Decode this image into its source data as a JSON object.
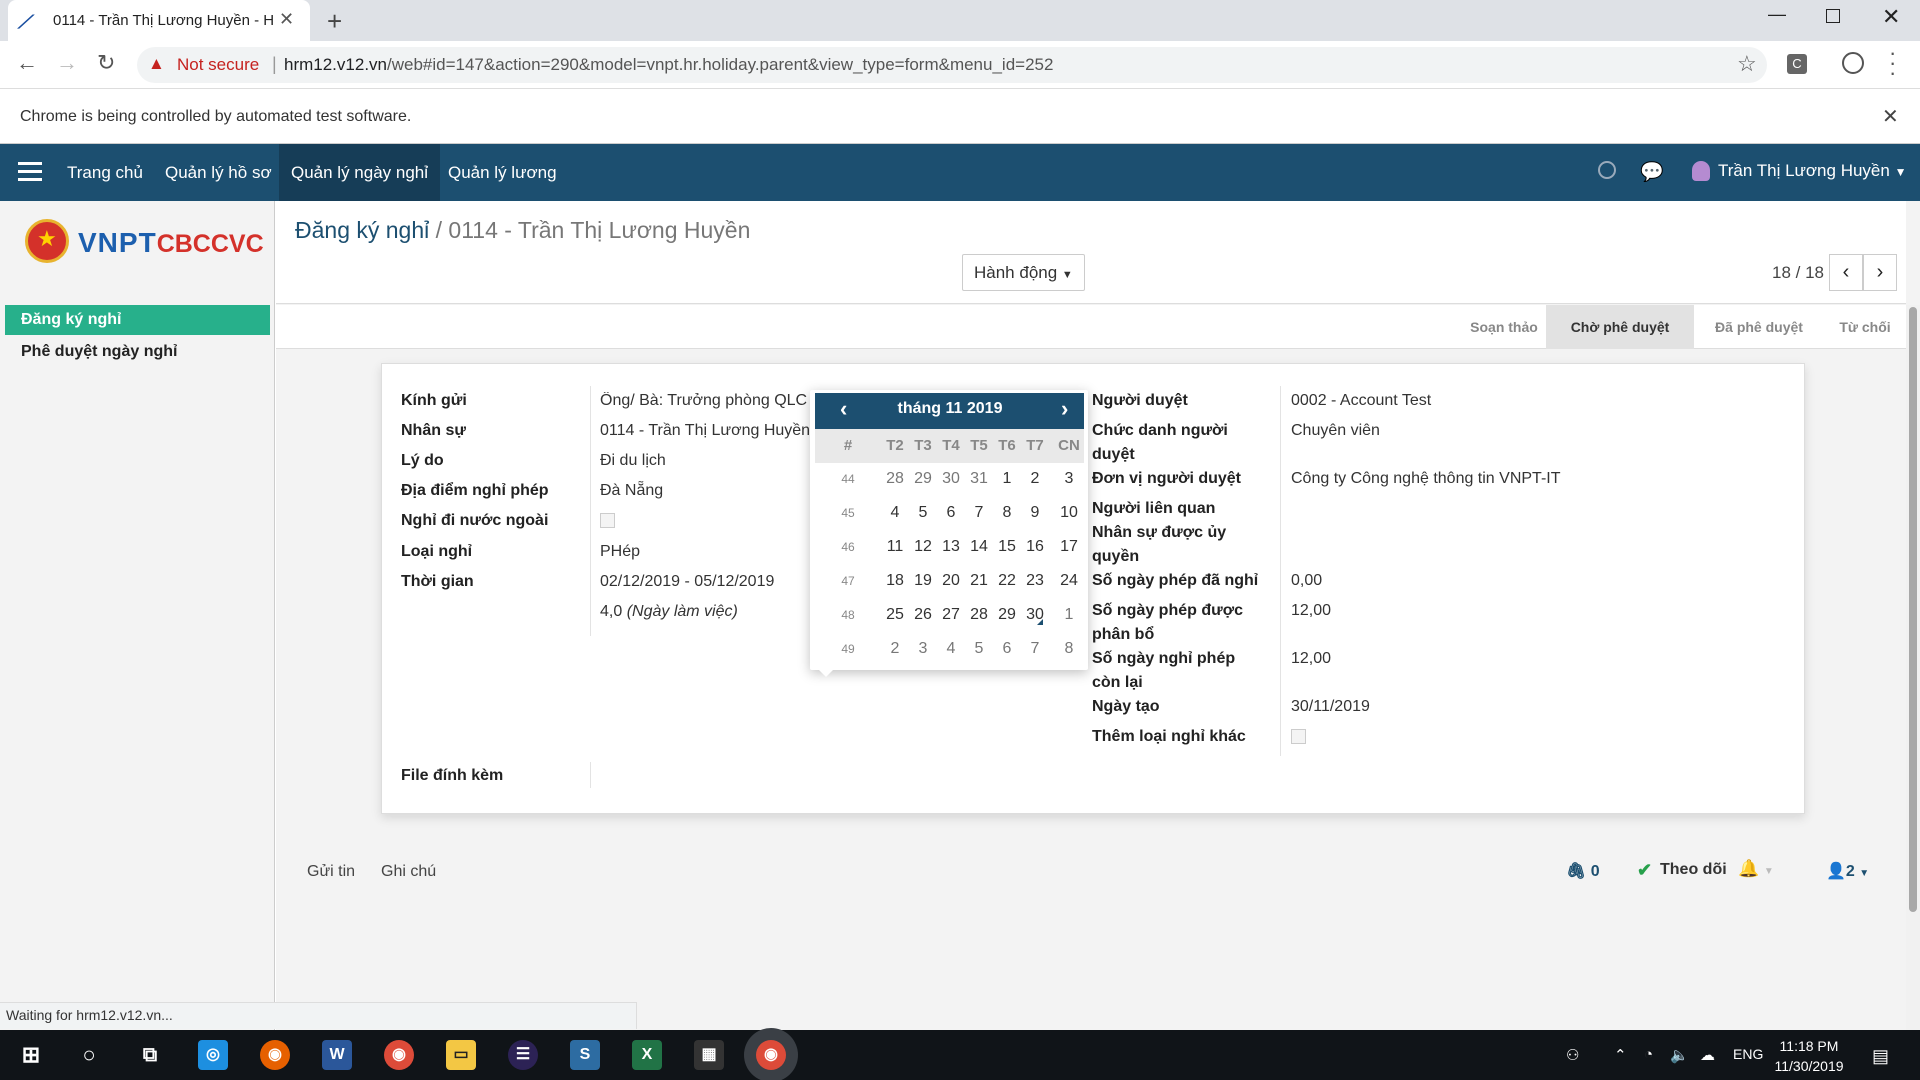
{
  "browser": {
    "tab_title": "0114 - Trần Thị Lương Huyền - H",
    "not_secure": "Not secure",
    "url_host": "hrm12.v12.vn",
    "url_path": "/web#id=147&action=290&model=vnpt.hr.holiday.parent&view_type=form&menu_id=252",
    "infobar": "Chrome is being controlled by automated test software.",
    "status_tip": "Waiting for hrm12.v12.vn..."
  },
  "nav": {
    "items": [
      "Trang chủ",
      "Quản lý hồ sơ",
      "Quản lý ngày nghỉ",
      "Quản lý lương"
    ],
    "active_index": 2,
    "user": "Trần Thị Lương Huyền"
  },
  "sidebar": {
    "logo_main": "VNPT",
    "logo_sub": "CBCCVC",
    "items": [
      "Đăng ký nghỉ",
      "Phê duyệt ngày nghỉ"
    ]
  },
  "control_panel": {
    "breadcrumb_parent": "Đăng ký nghỉ",
    "breadcrumb_sep": "/",
    "breadcrumb_current": "0114 - Trần Thị Lương Huyền",
    "action_label": "Hành động",
    "pager": "18 / 18"
  },
  "stages": [
    "Soạn thảo",
    "Chờ phê duyệt",
    "Đã phê duyệt",
    "Từ chối"
  ],
  "form_left": {
    "kinh_gui_label": "Kính gửi",
    "kinh_gui_value": "Ông/ Bà: Trưởng phòng QLC",
    "nhan_su_label": "Nhân sự",
    "nhan_su_value": "0114 - Trần Thị Lương Huyền",
    "ly_do_label": "Lý do",
    "ly_do_value": "Đi du lịch",
    "dia_diem_label": "Địa điểm nghỉ phép",
    "dia_diem_value": "Đà Nẵng",
    "nuoc_ngoai_label": "Nghỉ đi nước ngoài",
    "loai_nghi_label": "Loại nghỉ",
    "loai_nghi_value": "PHép",
    "thoi_gian_label": "Thời gian",
    "thoi_gian_value": "02/12/2019 - 05/12/2019",
    "so_ngay_value": "4,0",
    "so_ngay_unit": "(Ngày làm việc)",
    "file_label": "File đính kèm"
  },
  "form_right": {
    "nguoi_duyet_label": "Người duyệt",
    "nguoi_duyet_value": "0002 - Account Test",
    "chuc_danh_label_1": "Chức danh người",
    "chuc_danh_label_2": "duyệt",
    "chuc_danh_value": "Chuyên viên",
    "don_vi_label": "Đơn vị người duyệt",
    "don_vi_value": "Công ty Công nghệ thông tin VNPT-IT",
    "lien_quan_label": "Người liên quan",
    "uy_quyen_label_1": "Nhân sự được ủy",
    "uy_quyen_label_2": "quyền",
    "da_nghi_label": "Số ngày phép đã nghỉ",
    "da_nghi_value": "0,00",
    "phan_bo_label_1": "Số ngày phép được",
    "phan_bo_label_2": "phân bổ",
    "phan_bo_value": "12,00",
    "con_lai_label_1": "Số ngày nghỉ phép",
    "con_lai_label_2": "còn lại",
    "con_lai_value": "12,00",
    "ngay_tao_label": "Ngày tạo",
    "ngay_tao_value": "30/11/2019",
    "them_loai_label": "Thêm loại nghỉ khác"
  },
  "datepicker": {
    "title": "tháng 11 2019",
    "week_header": "#",
    "dow": [
      "T2",
      "T3",
      "T4",
      "T5",
      "T6",
      "T7",
      "CN"
    ],
    "weeks": [
      {
        "wk": "44",
        "days": [
          "28",
          "29",
          "30",
          "31",
          "1",
          "2",
          "3"
        ]
      },
      {
        "wk": "45",
        "days": [
          "4",
          "5",
          "6",
          "7",
          "8",
          "9",
          "10"
        ]
      },
      {
        "wk": "46",
        "days": [
          "11",
          "12",
          "13",
          "14",
          "15",
          "16",
          "17"
        ]
      },
      {
        "wk": "47",
        "days": [
          "18",
          "19",
          "20",
          "21",
          "22",
          "23",
          "24"
        ]
      },
      {
        "wk": "48",
        "days": [
          "25",
          "26",
          "27",
          "28",
          "29",
          "30",
          "1"
        ]
      },
      {
        "wk": "49",
        "days": [
          "2",
          "3",
          "4",
          "5",
          "6",
          "7",
          "8"
        ]
      }
    ]
  },
  "chatter": {
    "send_message": "Gửi tin",
    "log_note": "Ghi chú",
    "attachments": "0",
    "follow": "Theo dõi",
    "followers": "2"
  },
  "taskbar": {
    "lang": "ENG",
    "time": "11:18 PM",
    "date": "11/30/2019"
  }
}
